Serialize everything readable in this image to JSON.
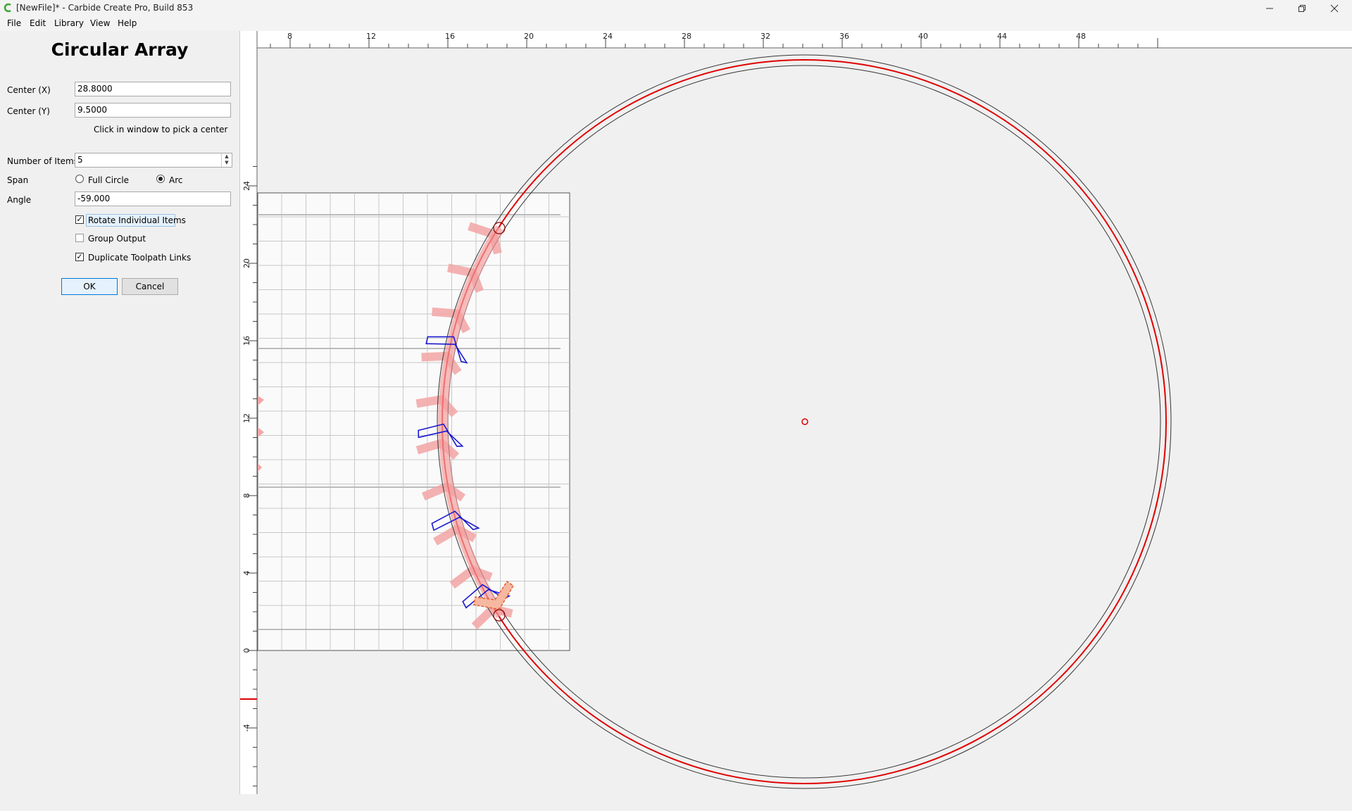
{
  "window": {
    "title": "[NewFile]* - Carbide Create Pro, Build 853",
    "app_icon": "carbide-logo-icon",
    "controls": [
      "minimize-icon",
      "restore-icon",
      "close-icon"
    ]
  },
  "menu": [
    {
      "label": "File"
    },
    {
      "label": "Edit"
    },
    {
      "label": "Library"
    },
    {
      "label": "View"
    },
    {
      "label": "Help"
    }
  ],
  "panel": {
    "title": "Circular Array",
    "center_x": {
      "label": "Center (X)",
      "value": "28.8000"
    },
    "center_y": {
      "label": "Center (Y)",
      "value": "9.5000"
    },
    "pick_hint": "Click in window to pick a center",
    "num_items": {
      "label": "Number of Items",
      "value": "5"
    },
    "span": {
      "label": "Span",
      "full_circle": "Full Circle",
      "arc": "Arc",
      "selected": "Arc"
    },
    "angle": {
      "label": "Angle",
      "value": "-59.000"
    },
    "rotate_individual": {
      "label": "Rotate Individual Items",
      "checked": true
    },
    "group_output": {
      "label": "Group Output",
      "checked": false
    },
    "duplicate_links": {
      "label": "Duplicate Toolpath Links",
      "checked": true
    },
    "ok_label": "OK",
    "cancel_label": "Cancel"
  },
  "ruler": {
    "top_labels": [
      "8",
      "12",
      "16",
      "20",
      "24",
      "28",
      "32",
      "36",
      "40",
      "44",
      "48"
    ],
    "left_labels": [
      "24",
      "20",
      "16",
      "12",
      "8",
      "4",
      "0",
      "-4"
    ]
  },
  "colors": {
    "circle_offset": "#e00000",
    "selected_outline": "#1a1ad0",
    "ghost_fill": "#f4a0a0",
    "stock": "#fafafa"
  }
}
